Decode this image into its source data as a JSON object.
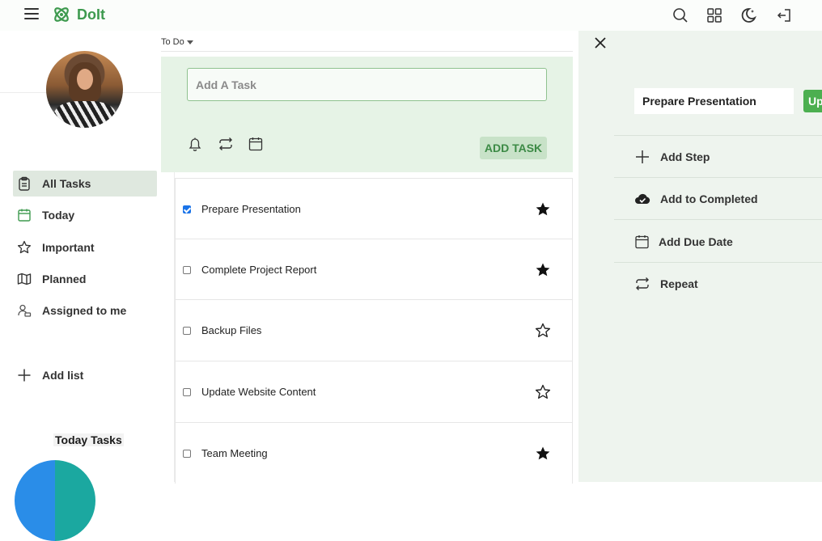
{
  "app": {
    "name": "DoIt"
  },
  "colors": {
    "brand": "#3e9a4f",
    "composer_bg": "#e6f3e6",
    "detail_bg": "#eef4ee",
    "active_nav": "#dfe8df",
    "update_button": "#4caf50"
  },
  "header": {
    "icons": [
      "menu-icon",
      "search-icon",
      "grid-icon",
      "theme-toggle-icon",
      "logout-icon"
    ]
  },
  "sidebar": {
    "items": [
      {
        "label": "All Tasks",
        "icon": "clipboard-icon",
        "active": true
      },
      {
        "label": "Today",
        "icon": "calendar-icon",
        "active": false
      },
      {
        "label": "Important",
        "icon": "star-icon",
        "active": false
      },
      {
        "label": "Planned",
        "icon": "map-icon",
        "active": false
      },
      {
        "label": "Assigned to me",
        "icon": "assigned-icon",
        "active": false
      }
    ],
    "add_list_label": "Add list",
    "today_tasks_title": "Today Tasks"
  },
  "main": {
    "list_title": "To Do",
    "input_placeholder": "Add A Task",
    "add_task_label": "ADD TASK",
    "tasks": [
      {
        "name": "Prepare Presentation",
        "completed": true,
        "important": true
      },
      {
        "name": "Complete Project Report",
        "completed": false,
        "important": true
      },
      {
        "name": "Backup Files",
        "completed": false,
        "important": false
      },
      {
        "name": "Update Website Content",
        "completed": false,
        "important": false
      },
      {
        "name": "Team Meeting",
        "completed": false,
        "important": true
      }
    ]
  },
  "detail": {
    "task_name": "Prepare Presentation",
    "update_label": "Update",
    "actions": [
      {
        "label": "Add Step",
        "icon": "plus-icon"
      },
      {
        "label": "Add to Completed",
        "icon": "cloud-check-icon"
      },
      {
        "label": "Add Due Date",
        "icon": "calendar-icon"
      },
      {
        "label": "Repeat",
        "icon": "repeat-icon"
      }
    ]
  }
}
